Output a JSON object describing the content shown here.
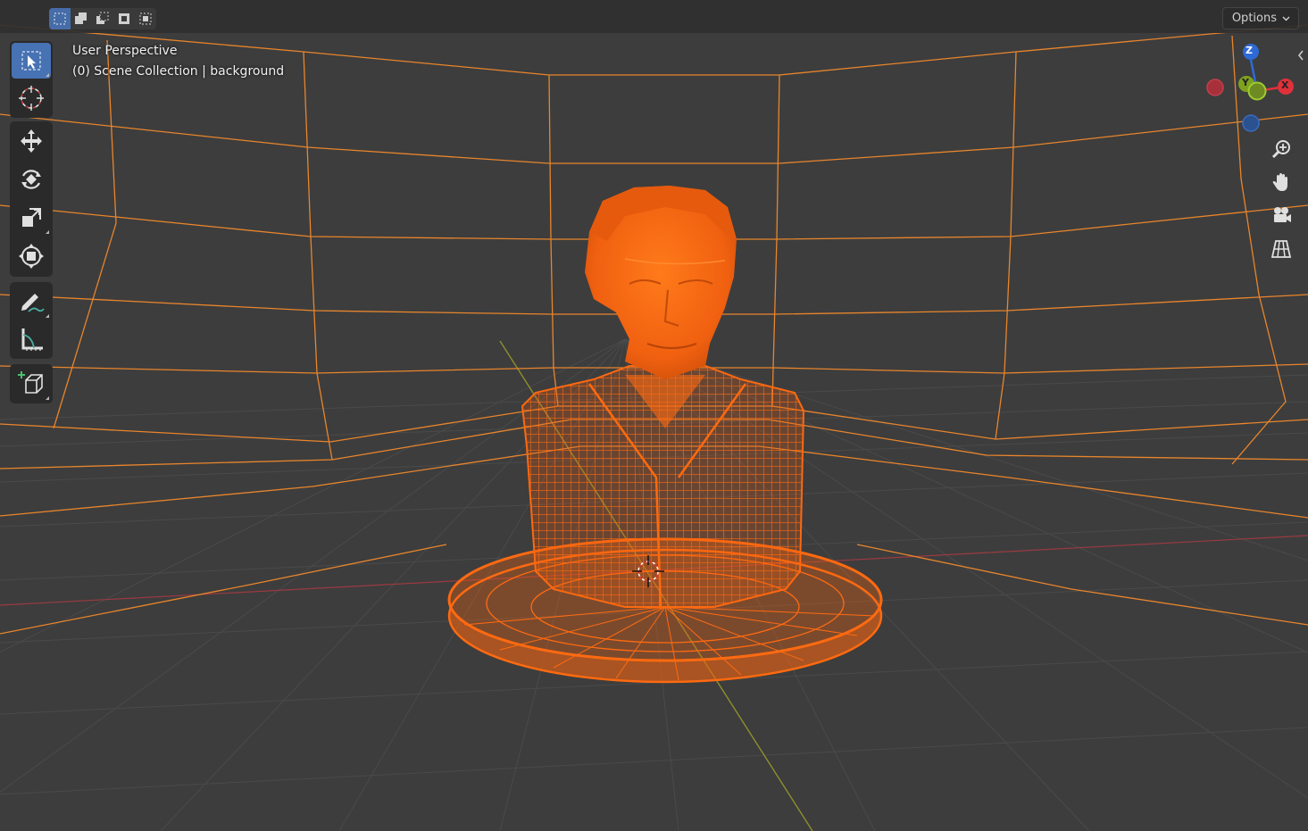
{
  "header": {
    "select_modes": [
      {
        "name": "set-new-selection",
        "active": true
      },
      {
        "name": "extend-selection",
        "active": false
      },
      {
        "name": "subtract-selection",
        "active": false
      },
      {
        "name": "invert-selection",
        "active": false
      },
      {
        "name": "intersect-selection",
        "active": false
      }
    ],
    "options_label": "Options"
  },
  "viewport": {
    "perspective_label": "User Perspective",
    "collection_label": "(0) Scene Collection | background"
  },
  "toolbar": {
    "tools": [
      {
        "name": "select-box",
        "icon": "select-box-icon",
        "active": true
      },
      {
        "name": "cursor",
        "icon": "cursor-icon",
        "active": false
      },
      {
        "name": "move",
        "icon": "move-icon",
        "active": false
      },
      {
        "name": "rotate",
        "icon": "rotate-icon",
        "active": false
      },
      {
        "name": "scale",
        "icon": "scale-icon",
        "active": false
      },
      {
        "name": "transform",
        "icon": "transform-icon",
        "active": false
      },
      {
        "name": "annotate",
        "icon": "annotate-icon",
        "active": false
      },
      {
        "name": "measure",
        "icon": "measure-icon",
        "active": false
      },
      {
        "name": "add-cube",
        "icon": "add-cube-icon",
        "active": false
      }
    ]
  },
  "gizmo": {
    "axis_z": "Z",
    "axis_y": "Y",
    "axis_x": "X",
    "colors": {
      "x": "#e0313b",
      "y": "#7ea11f",
      "z": "#2e6ad6"
    }
  },
  "nav_buttons": [
    {
      "name": "zoom",
      "icon": "zoom-icon"
    },
    {
      "name": "pan",
      "icon": "hand-icon"
    },
    {
      "name": "camera",
      "icon": "camera-icon"
    },
    {
      "name": "ortho-toggle",
      "icon": "grid-icon"
    }
  ],
  "colors": {
    "background": "#3d3d3d",
    "selection_orange": "#ff6a00",
    "wire_orange": "#e8852c",
    "accent_blue": "#4772b3"
  }
}
